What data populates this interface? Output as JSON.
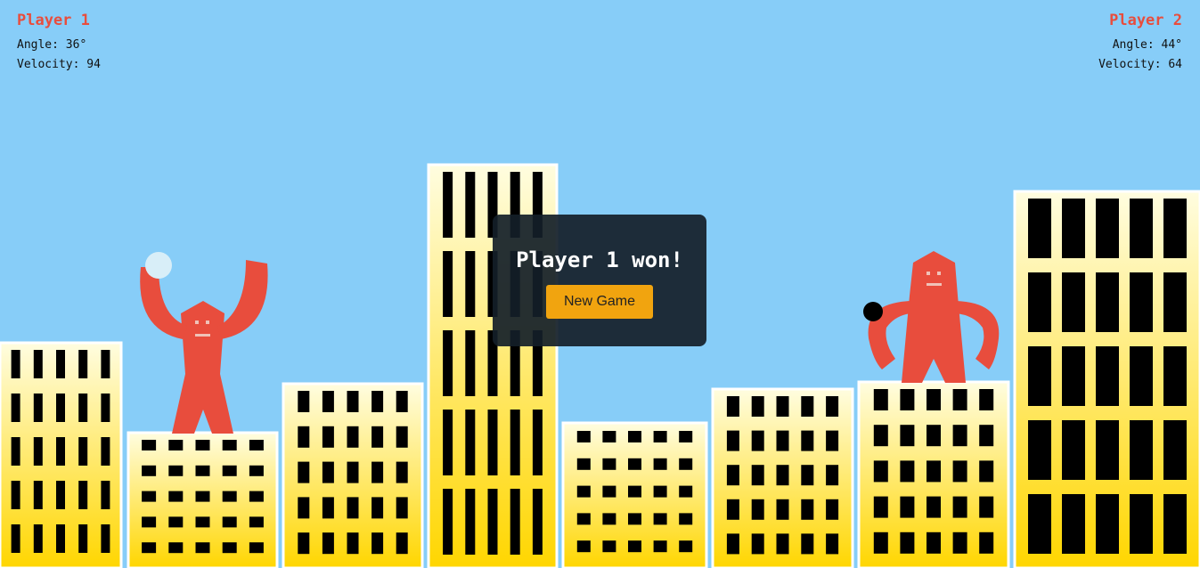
{
  "player1": {
    "name": "Player 1",
    "angle": "Angle: 36°",
    "velocity": "Velocity: 94"
  },
  "player2": {
    "name": "Player 2",
    "angle": "Angle: 44°",
    "velocity": "Velocity: 64"
  },
  "dialog": {
    "message": "Player 1 won!",
    "button_label": "New Game"
  },
  "colors": {
    "sky": "#87cdf8",
    "gorilla": "#e84d3d",
    "building_top": "#fffde0",
    "building_bottom": "#ffd600",
    "window": "#000000",
    "dialog_bg": "#141e28",
    "button": "#f1a40f"
  },
  "icons": {
    "gorilla_left": "gorilla-arms-raised-icon",
    "gorilla_right": "gorilla-holding-bomb-icon",
    "bomb": "bomb-icon",
    "impact": "explosion-hole-icon"
  }
}
